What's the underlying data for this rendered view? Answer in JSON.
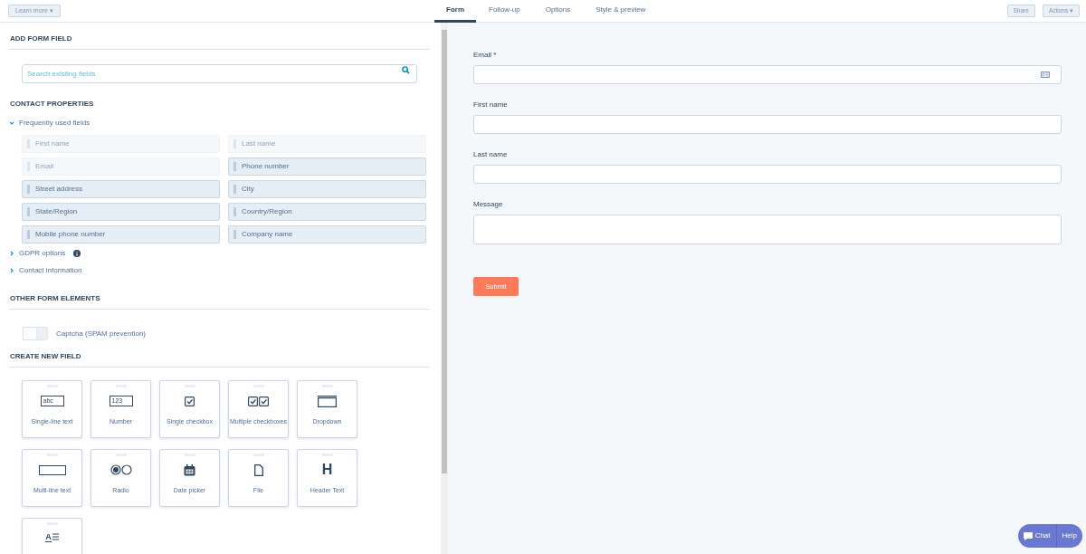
{
  "header": {
    "learn_more": "Learn more ▾",
    "tabs": [
      {
        "label": "Form",
        "selected": true
      },
      {
        "label": "Follow-up",
        "selected": false
      },
      {
        "label": "Options",
        "selected": false
      },
      {
        "label": "Style & preview",
        "selected": false
      }
    ],
    "buttons": [
      "Share",
      "Actions ▾"
    ]
  },
  "sidebar": {
    "add_form_field": {
      "title": "ADD FORM FIELD",
      "search": {
        "placeholder": "Search existing fields"
      }
    },
    "contact_properties": {
      "title": "CONTACT PROPERTIES",
      "groups": [
        {
          "label": "Frequently used fields",
          "expanded": true,
          "fields": [
            {
              "label": "First name",
              "disabled": true
            },
            {
              "label": "Last name",
              "disabled": true
            },
            {
              "label": "Email",
              "disabled": true
            },
            {
              "label": "Phone number",
              "disabled": false
            },
            {
              "label": "Street address",
              "disabled": false
            },
            {
              "label": "City",
              "disabled": false
            },
            {
              "label": "State/Region",
              "disabled": false
            },
            {
              "label": "Country/Region",
              "disabled": false
            },
            {
              "label": "Mobile phone number",
              "disabled": false
            },
            {
              "label": "Company name",
              "disabled": false
            }
          ]
        },
        {
          "label": "GDPR options",
          "expanded": false,
          "info": true
        },
        {
          "label": "Contact information",
          "expanded": false
        }
      ]
    },
    "other_form_elements": {
      "title": "OTHER FORM ELEMENTS",
      "captcha": {
        "label": "Captcha (SPAM prevention)",
        "on": false
      }
    },
    "create_new_field": {
      "title": "CREATE NEW FIELD",
      "types": [
        {
          "kind": "single_line",
          "label": "Single-line text",
          "icon_text": "abc"
        },
        {
          "kind": "number",
          "label": "Number",
          "icon_text": "123"
        },
        {
          "kind": "checkbox",
          "label": "Single checkbox"
        },
        {
          "kind": "checkboxes",
          "label": "Multiple checkboxes"
        },
        {
          "kind": "dropdown",
          "label": "Dropdown"
        },
        {
          "kind": "multi_line",
          "label": "Multi-line text"
        },
        {
          "kind": "radio",
          "label": "Radio"
        },
        {
          "kind": "date",
          "label": "Date picker"
        },
        {
          "kind": "file",
          "label": "File"
        },
        {
          "kind": "header",
          "label": "Header Text",
          "icon_text": "H"
        },
        {
          "kind": "rich_text",
          "icon_text": "A"
        }
      ]
    }
  },
  "form": {
    "fields": [
      {
        "label": "Email *",
        "kind": "email"
      },
      {
        "label": "First name",
        "kind": "text"
      },
      {
        "label": "Last name",
        "kind": "text"
      },
      {
        "label": "Message",
        "kind": "textarea"
      }
    ],
    "submit": "Submit"
  },
  "chat_widget": {
    "chat": "Chat",
    "help": "Help"
  }
}
